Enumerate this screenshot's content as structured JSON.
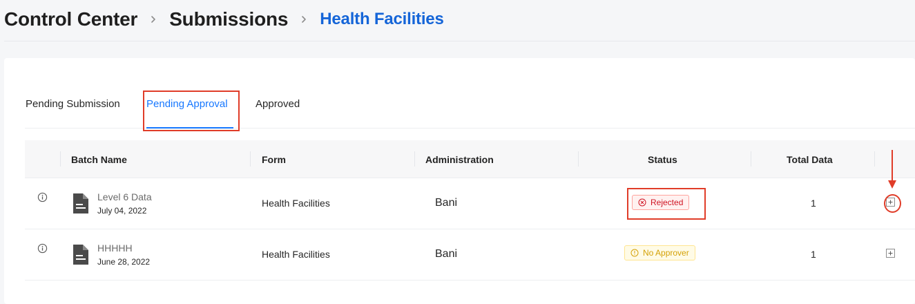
{
  "breadcrumb": {
    "items": [
      "Control Center",
      "Submissions",
      "Health Facilities"
    ]
  },
  "tabs": {
    "items": [
      "Pending Submission",
      "Pending Approval",
      "Approved"
    ],
    "active_index": 1
  },
  "table": {
    "headers": {
      "batch_name": "Batch Name",
      "form": "Form",
      "administration": "Administration",
      "status": "Status",
      "total_data": "Total Data"
    },
    "rows": [
      {
        "name": "Level 6 Data",
        "date": "July 04, 2022",
        "form": "Health Facilities",
        "administration": "Bani",
        "status": "Rejected",
        "status_type": "rejected",
        "total": "1"
      },
      {
        "name": "HHHHH",
        "date": "June 28, 2022",
        "form": "Health Facilities",
        "administration": "Bani",
        "status": "No Approver",
        "status_type": "warning",
        "total": "1"
      }
    ]
  },
  "icons": {
    "breadcrumb_separator": "chevron-right-icon",
    "row_info": "info-circle-icon",
    "batch_file": "file-text-icon",
    "rejected": "close-circle-icon",
    "no_approver": "exclamation-circle-icon",
    "expand": "plus-square-icon",
    "annotation_arrow": "arrow-down-icon"
  },
  "colors": {
    "accent": "#1677ff",
    "breadcrumb_active": "#1565d8",
    "rejected": "#cf1322",
    "warning": "#d4a106",
    "annotation": "#e03c28"
  }
}
